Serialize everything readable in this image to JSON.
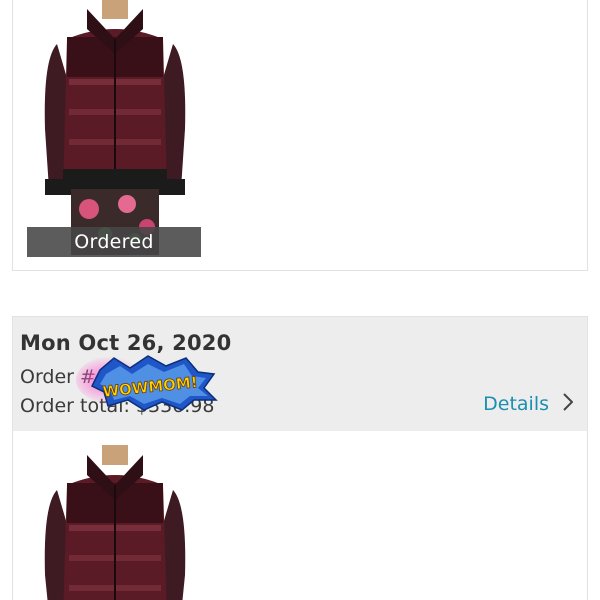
{
  "orders": [
    {
      "status_badge": "Ordered"
    },
    {
      "date": "Mon Oct 26, 2020",
      "order_number_label": "Order #",
      "order_total_label": "Order total:",
      "order_total_value": "$336.98",
      "details_label": "Details"
    }
  ],
  "sticker": {
    "text": "WOWMOM!"
  },
  "colors": {
    "accent_link": "#1a8fb0",
    "header_bg": "#ededed",
    "badge_bg": "#464646",
    "jacket": "#4a1a22"
  },
  "icons": {
    "details_chevron": "chevron-right-icon"
  }
}
